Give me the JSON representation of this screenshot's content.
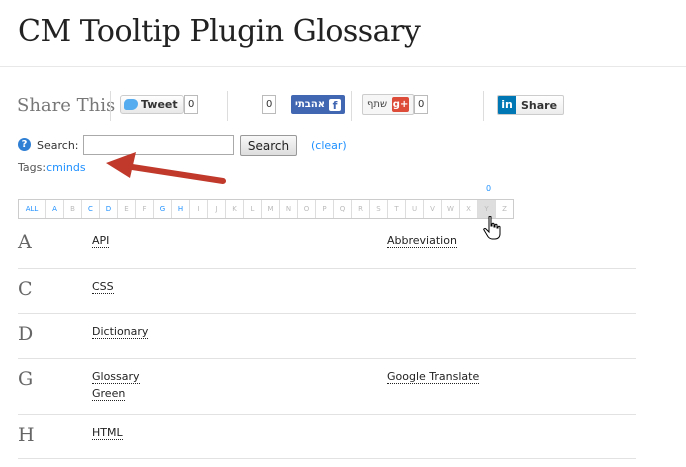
{
  "page": {
    "title": "CM Tooltip Plugin Glossary"
  },
  "share": {
    "label": "Share This",
    "tweet_label": "Tweet",
    "tweet_count": "0",
    "fb_count": "0",
    "fb_label": "אהבתי",
    "gplus_label": "שתף",
    "gplus_count": "0",
    "linkedin_label": "Share"
  },
  "search": {
    "label": "Search:",
    "value": "",
    "button_label": "Search",
    "clear_label": "(clear)"
  },
  "tags": {
    "label": "Tags:",
    "link": "cminds"
  },
  "letter_nav": {
    "hover_count": "0",
    "items": [
      {
        "label": "ALL",
        "active": true
      },
      {
        "label": "A",
        "active": true
      },
      {
        "label": "B",
        "active": false
      },
      {
        "label": "C",
        "active": true
      },
      {
        "label": "D",
        "active": true
      },
      {
        "label": "E",
        "active": false
      },
      {
        "label": "F",
        "active": false
      },
      {
        "label": "G",
        "active": true
      },
      {
        "label": "H",
        "active": true
      },
      {
        "label": "I",
        "active": false
      },
      {
        "label": "J",
        "active": false
      },
      {
        "label": "K",
        "active": false
      },
      {
        "label": "L",
        "active": false
      },
      {
        "label": "M",
        "active": false
      },
      {
        "label": "N",
        "active": false
      },
      {
        "label": "O",
        "active": false
      },
      {
        "label": "P",
        "active": false
      },
      {
        "label": "Q",
        "active": false
      },
      {
        "label": "R",
        "active": false
      },
      {
        "label": "S",
        "active": false
      },
      {
        "label": "T",
        "active": false
      },
      {
        "label": "U",
        "active": false
      },
      {
        "label": "V",
        "active": false
      },
      {
        "label": "W",
        "active": false
      },
      {
        "label": "X",
        "active": false
      },
      {
        "label": "Y",
        "active": false
      },
      {
        "label": "Z",
        "active": false
      }
    ]
  },
  "glossary": [
    {
      "letter": "A",
      "col1": [
        "API"
      ],
      "col2": [
        "Abbreviation"
      ]
    },
    {
      "letter": "C",
      "col1": [
        "CSS"
      ],
      "col2": []
    },
    {
      "letter": "D",
      "col1": [
        "Dictionary"
      ],
      "col2": []
    },
    {
      "letter": "G",
      "col1": [
        "Glossary",
        "Green"
      ],
      "col2": [
        "Google Translate"
      ]
    },
    {
      "letter": "H",
      "col1": [
        "HTML"
      ],
      "col2": []
    }
  ],
  "icons": {
    "help": "help-icon",
    "arrow": "red-arrow-annotation",
    "cursor": "hand-cursor-icon"
  },
  "colors": {
    "link": "#1e90ff",
    "facebook": "#4267b2",
    "gplus": "#dd4b39",
    "linkedin": "#0077b5",
    "twitter": "#55acee",
    "arrow": "#c0392b"
  }
}
